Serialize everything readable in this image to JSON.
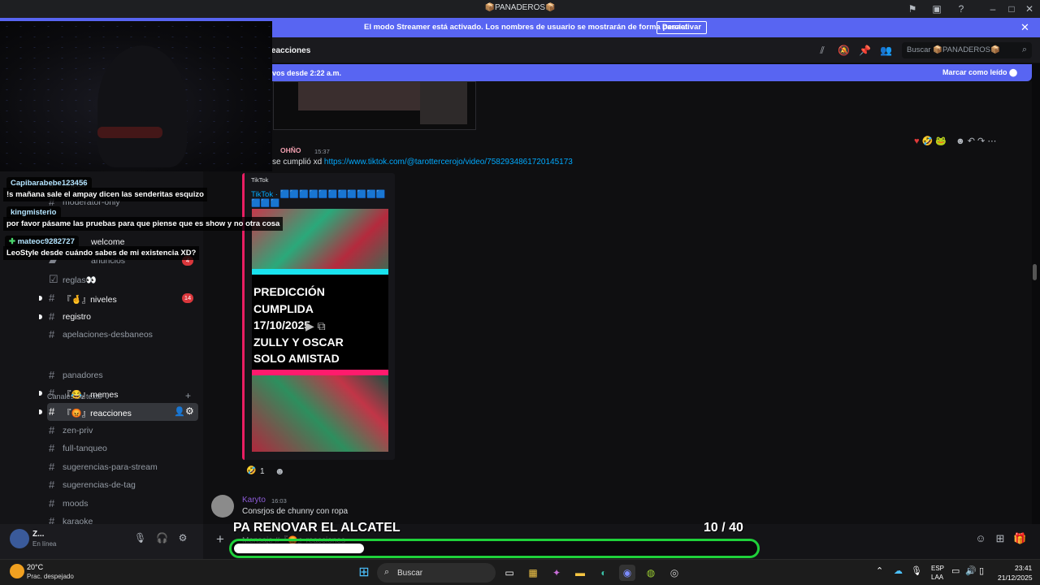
{
  "window": {
    "title": "📦PANADEROS📦"
  },
  "streamer_banner": {
    "message": "El modo Streamer está activado. Los nombres de usuario se mostrarán de forma parcial.",
    "button": "Desactivar"
  },
  "channel_header": {
    "name": "reacciones",
    "search_placeholder": "Buscar 📦PANADEROS📦"
  },
  "new_messages": {
    "text": "vos desde 2:22 a.m.",
    "mark_read": "Marcar como leído"
  },
  "sidebar": {
    "channels": [
      {
        "label": "reglas"
      },
      {
        "label": "moderator-only"
      },
      {
        "label": "welcome"
      },
      {
        "label": "anuncios",
        "badge": "4"
      },
      {
        "label": "reglas👀"
      },
      {
        "label": "『🤞』niveles",
        "badge": "14"
      },
      {
        "label": "registro"
      },
      {
        "label": "apelaciones-desbaneos"
      }
    ],
    "category": "Canales de texto",
    "text_channels": [
      {
        "label": "panadores"
      },
      {
        "label": "『😂』memes"
      },
      {
        "label": "『😡』reacciones"
      },
      {
        "label": "zen-priv"
      },
      {
        "label": "full-tanqueo"
      },
      {
        "label": "sugerencias-para-stream"
      },
      {
        "label": "sugerencias-de-tag"
      },
      {
        "label": "moods"
      },
      {
        "label": "karaoke"
      }
    ]
  },
  "user_panel": {
    "name": "Z...",
    "status": "En línea"
  },
  "messages": [
    {
      "role": "OHÑO",
      "time": "15:37",
      "text": "se cumplió xd ",
      "link": "https://www.tiktok.com/@tarottercerojo/video/7582934861720145173",
      "embed": {
        "provider": "TikTok",
        "title": "TikTok · 🟦🟦🟦🟦🟦🟦🟦🟦🟦🟦🟦🟦🟦🟦",
        "video_text": "PREDICCIÓN\nCUMPLIDA\n17/10/2025\nZULLY Y OSCAR\nSOLO AMISTAD"
      },
      "reaction_count": "1"
    },
    {
      "name": "Karyto",
      "time": "16:03",
      "text": "Consrjos de chunny con ropa"
    }
  ],
  "composer": {
    "placeholder": "Mensaje #『😡』reacciones"
  },
  "stream_chat": [
    {
      "user": "Capibarabebe123456",
      "text": "!s mañana sale el ampay dicen las senderitas esquizo"
    },
    {
      "user": "kingmisterio",
      "text": "por favor pásame las pruebas para que piense que es show y no otra cosa"
    },
    {
      "user": "mateoc9282727",
      "text": "LeoStyle desde cuándo sabes de mi existencia XD?"
    }
  ],
  "goal": {
    "title": "PA RENOVAR EL ALCATEL",
    "current": "10",
    "target": "/ 40",
    "progress": 0.25
  },
  "taskbar": {
    "temp": "20°C",
    "condition": "Prac. despejado",
    "search": "Buscar",
    "lang1": "ESP",
    "lang2": "LAA",
    "time": "23:41",
    "date": "21/12/2025"
  }
}
